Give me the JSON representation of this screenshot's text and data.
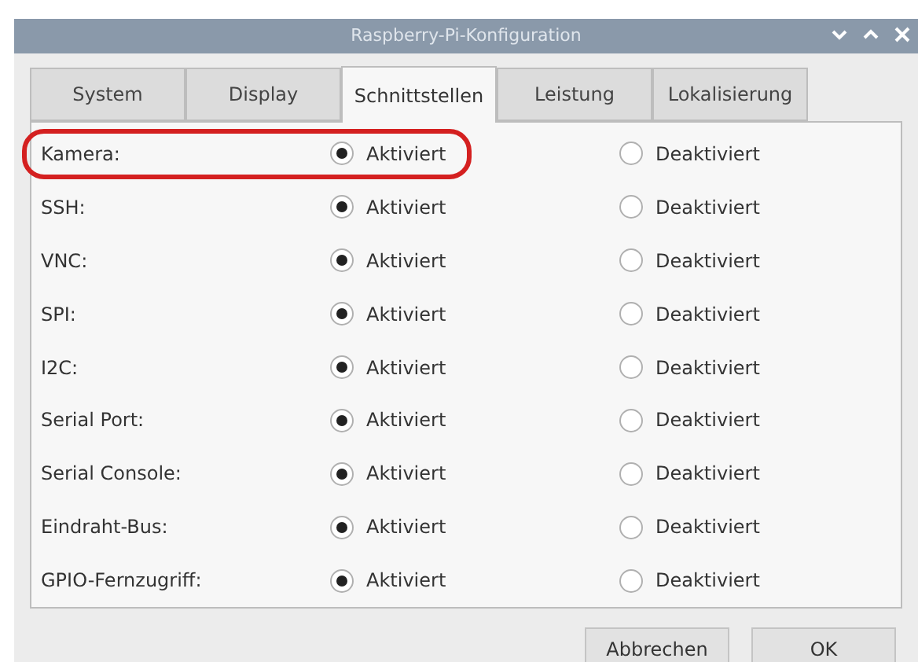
{
  "window": {
    "title": "Raspberry-Pi-Konfiguration"
  },
  "tabs": [
    {
      "label": "System",
      "selected": false
    },
    {
      "label": "Display",
      "selected": false
    },
    {
      "label": "Schnittstellen",
      "selected": true
    },
    {
      "label": "Leistung",
      "selected": false
    },
    {
      "label": "Lokalisierung",
      "selected": false
    }
  ],
  "rows": [
    {
      "label": "Kamera:",
      "on_label": "Aktiviert",
      "off_label": "Deaktiviert",
      "enabled": true,
      "highlighted": true
    },
    {
      "label": "SSH:",
      "on_label": "Aktiviert",
      "off_label": "Deaktiviert",
      "enabled": true,
      "highlighted": false
    },
    {
      "label": "VNC:",
      "on_label": "Aktiviert",
      "off_label": "Deaktiviert",
      "enabled": true,
      "highlighted": false
    },
    {
      "label": "SPI:",
      "on_label": "Aktiviert",
      "off_label": "Deaktiviert",
      "enabled": true,
      "highlighted": false
    },
    {
      "label": "I2C:",
      "on_label": "Aktiviert",
      "off_label": "Deaktiviert",
      "enabled": true,
      "highlighted": false
    },
    {
      "label": "Serial Port:",
      "on_label": "Aktiviert",
      "off_label": "Deaktiviert",
      "enabled": true,
      "highlighted": false
    },
    {
      "label": "Serial Console:",
      "on_label": "Aktiviert",
      "off_label": "Deaktiviert",
      "enabled": true,
      "highlighted": false
    },
    {
      "label": "Eindraht-Bus:",
      "on_label": "Aktiviert",
      "off_label": "Deaktiviert",
      "enabled": true,
      "highlighted": false
    },
    {
      "label": "GPIO-Fernzugriff:",
      "on_label": "Aktiviert",
      "off_label": "Deaktiviert",
      "enabled": true,
      "highlighted": false
    }
  ],
  "buttons": [
    "Abbrechen",
    "OK"
  ]
}
